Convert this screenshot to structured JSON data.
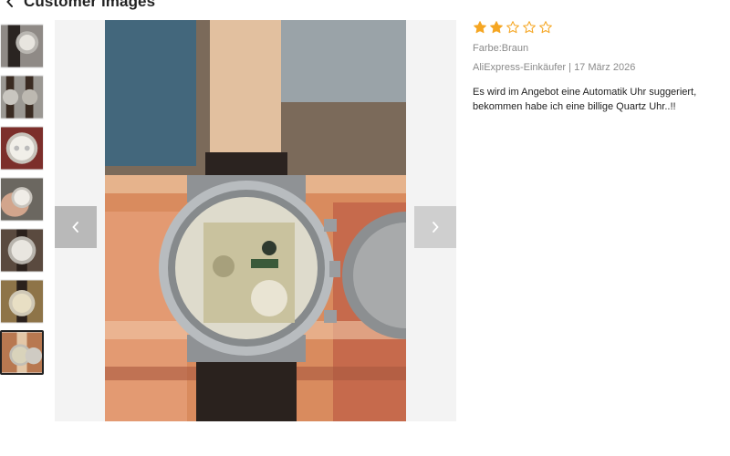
{
  "header": {
    "title": "Customer images"
  },
  "thumbnails": [
    {
      "alt": "thumbnail-1"
    },
    {
      "alt": "thumbnail-2"
    },
    {
      "alt": "thumbnail-3"
    },
    {
      "alt": "thumbnail-4"
    },
    {
      "alt": "thumbnail-5"
    },
    {
      "alt": "thumbnail-6"
    },
    {
      "alt": "thumbnail-7"
    }
  ],
  "active_thumbnail_index": 6,
  "review": {
    "rating": 2,
    "max_rating": 5,
    "color_option": "Farbe:Braun",
    "author_date": "AliExpress-Einkäufer | 17 März 2026",
    "text": "Es wird im Angebot eine Automatik Uhr suggeriert, bekommen habe ich eine billige Quartz Uhr..!!"
  },
  "colors": {
    "star": "#f5a623",
    "nav_bg": "#b9b9b9",
    "viewer_bg": "#f3f3f3"
  }
}
